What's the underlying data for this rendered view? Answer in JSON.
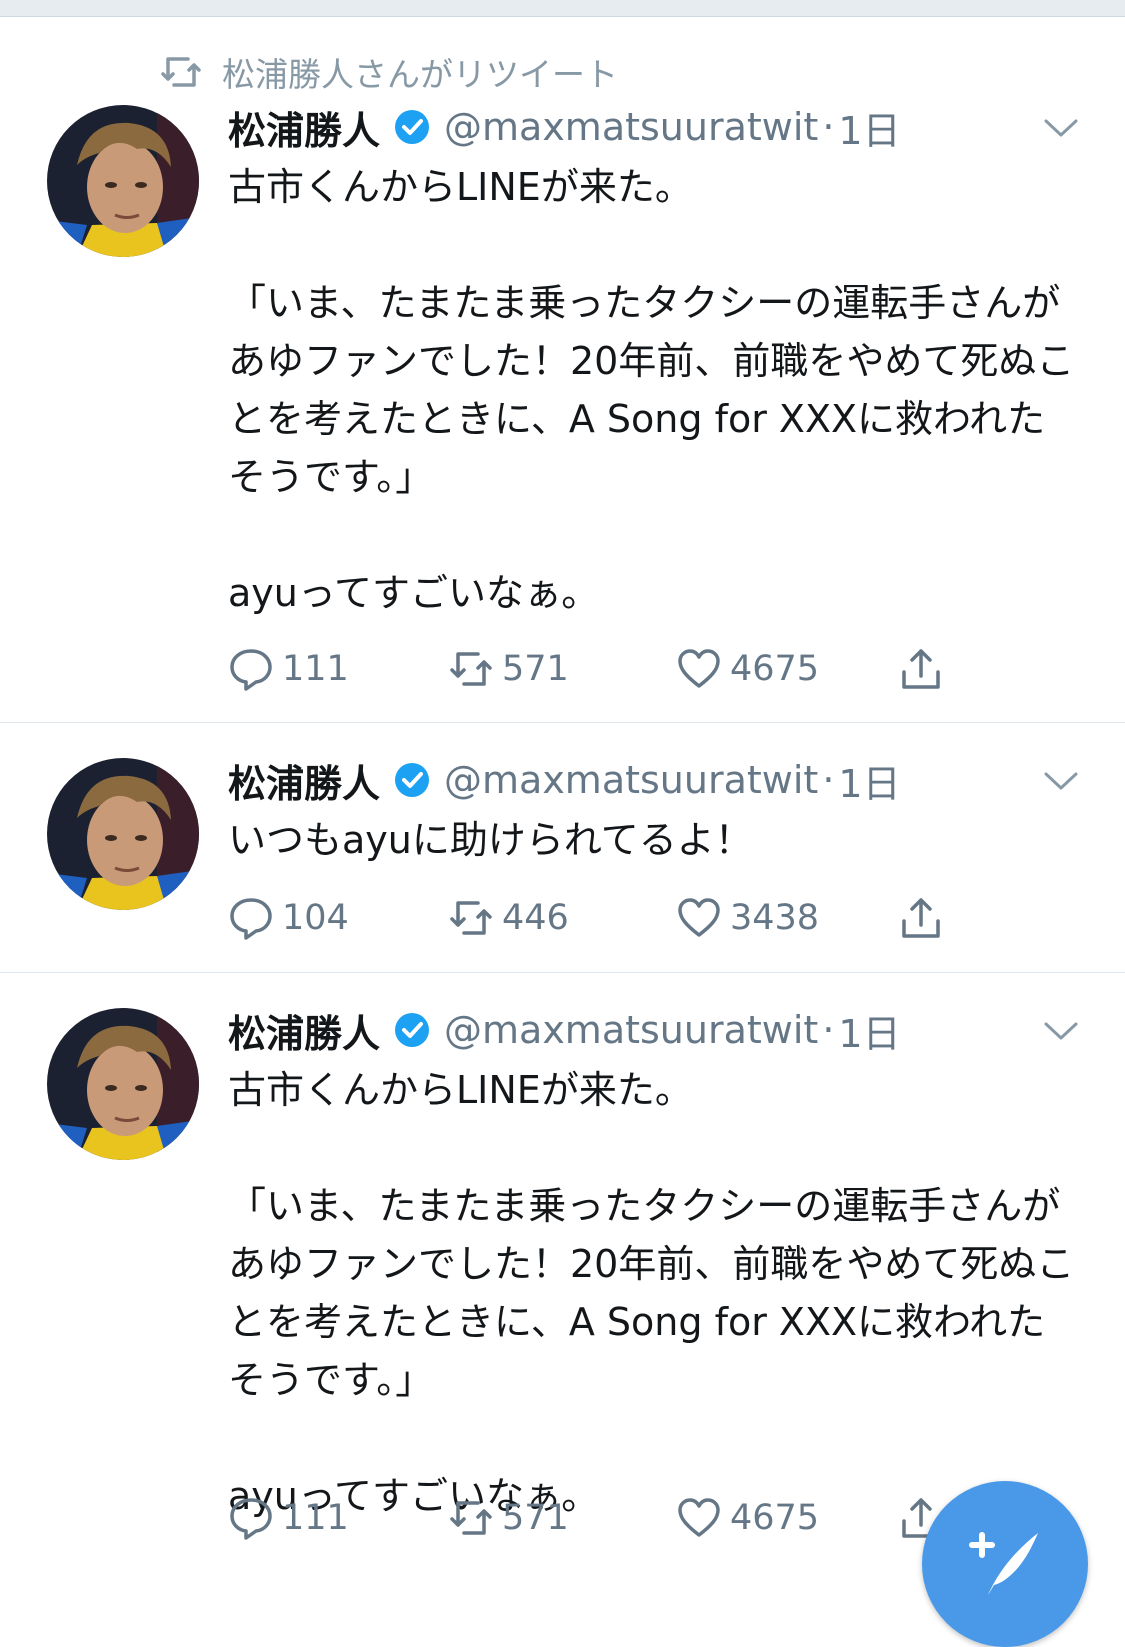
{
  "retweet_label": "松浦勝人さんがリツイート",
  "tweets": [
    {
      "name": "松浦勝人",
      "handle": "@maxmatsuuratwit",
      "dot": "·",
      "time": "1日",
      "text": "古市くんからLINEが来た。\n\n「いま、たまたま乗ったタクシーの運転手さんがあゆファンでした！20年前、前職をやめて死ぬことを考えたときに、A Song for XXXに救われたそうです。」\n\nayuってすごいなぁ。",
      "replies": "111",
      "retweets": "571",
      "likes": "4675"
    },
    {
      "name": "松浦勝人",
      "handle": "@maxmatsuuratwit",
      "dot": "·",
      "time": "1日",
      "text": "いつもayuに助けられてるよ！",
      "replies": "104",
      "retweets": "446",
      "likes": "3438"
    },
    {
      "name": "松浦勝人",
      "handle": "@maxmatsuuratwit",
      "dot": "·",
      "time": "1日",
      "text": "古市くんからLINEが来た。\n\n「いま、たまたま乗ったタクシーの運転手さんがあゆファンでした！20年前、前職をやめて死ぬことを考えたときに、A Song for XXXに救われたそうです。」\n\nayuってすごいなぁ。",
      "replies": "111",
      "retweets": "571",
      "likes": "4675"
    }
  ],
  "icons": {
    "retweet_context": "retweet-icon",
    "verified": "verified-badge-icon",
    "menu": "chevron-down-icon",
    "reply": "reply-icon",
    "retweet": "retweet-icon",
    "like": "heart-icon",
    "share": "share-icon",
    "compose": "compose-tweet-icon"
  },
  "colors": {
    "accent": "#1da1f2",
    "fab": "#4a99e9",
    "secondary_text": "#657786",
    "divider": "#e1e8ed"
  }
}
